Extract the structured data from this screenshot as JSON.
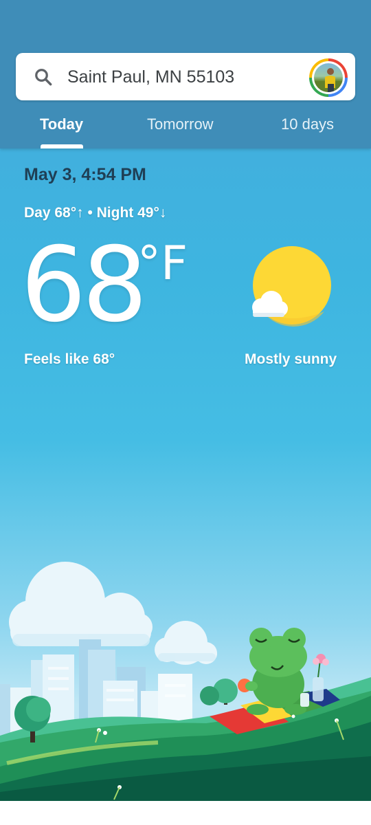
{
  "search": {
    "location": "Saint Paul, MN 55103",
    "icon": "search-icon"
  },
  "tabs": [
    {
      "label": "Today",
      "selected": true
    },
    {
      "label": "Tomorrow",
      "selected": false
    },
    {
      "label": "10 days",
      "selected": false
    }
  ],
  "weather": {
    "datetime": "May 3, 4:54 PM",
    "day_night": "Day 68°↑ • Night 49°↓",
    "temperature": "68",
    "unit": "°F",
    "feels_like": "Feels like 68°",
    "condition": "Mostly sunny",
    "condition_icon": "partly-sunny-icon"
  },
  "colors": {
    "header": "#3f8db8",
    "sky": "#45bde4",
    "sun": "#fdd835"
  }
}
